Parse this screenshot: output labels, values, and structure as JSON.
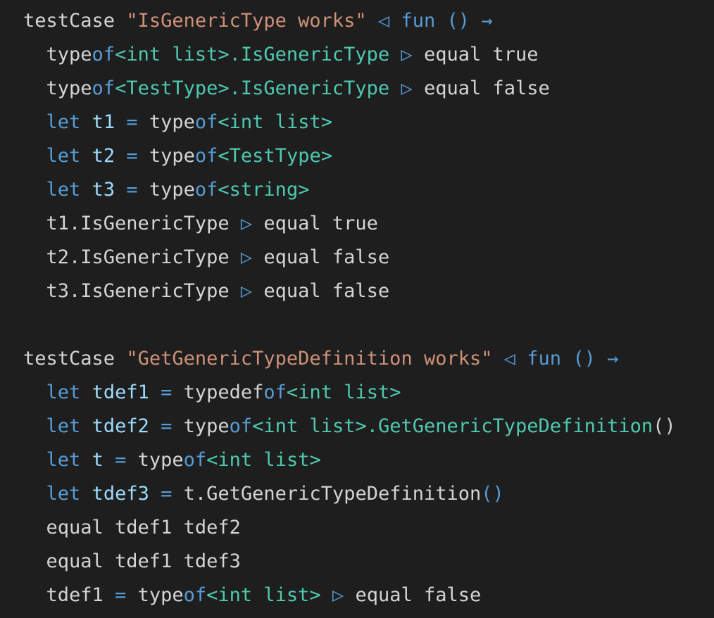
{
  "colors": {
    "background": "#1e1e1e",
    "default": "#d4d4d4",
    "keyword": "#569cd6",
    "string": "#ce9178",
    "type": "#4ec9b0",
    "variable": "#9cdcfe"
  },
  "lines": [
    {
      "tokens": [
        {
          "t": "testCase ",
          "c": "default"
        },
        {
          "t": "\"IsGenericType works\"",
          "c": "string"
        },
        {
          "t": " ",
          "c": "default"
        },
        {
          "t": "◁",
          "c": "keyword"
        },
        {
          "t": " ",
          "c": "default"
        },
        {
          "t": "fun",
          "c": "keyword"
        },
        {
          "t": " ",
          "c": "default"
        },
        {
          "t": "()",
          "c": "keyword"
        },
        {
          "t": " ",
          "c": "default"
        },
        {
          "t": "→",
          "c": "keyword"
        }
      ]
    },
    {
      "tokens": [
        {
          "t": "  type",
          "c": "default"
        },
        {
          "t": "of",
          "c": "keyword"
        },
        {
          "t": "<int list>.IsGenericType",
          "c": "type"
        },
        {
          "t": " ",
          "c": "default"
        },
        {
          "t": "▷",
          "c": "keyword"
        },
        {
          "t": " equal true",
          "c": "default"
        }
      ]
    },
    {
      "tokens": [
        {
          "t": "  type",
          "c": "default"
        },
        {
          "t": "of",
          "c": "keyword"
        },
        {
          "t": "<TestType>.IsGenericType",
          "c": "type"
        },
        {
          "t": " ",
          "c": "default"
        },
        {
          "t": "▷",
          "c": "keyword"
        },
        {
          "t": " equal false",
          "c": "default"
        }
      ]
    },
    {
      "tokens": [
        {
          "t": "  ",
          "c": "default"
        },
        {
          "t": "let",
          "c": "keyword"
        },
        {
          "t": " ",
          "c": "default"
        },
        {
          "t": "t1",
          "c": "variable"
        },
        {
          "t": " ",
          "c": "default"
        },
        {
          "t": "=",
          "c": "keyword"
        },
        {
          "t": " type",
          "c": "default"
        },
        {
          "t": "of",
          "c": "keyword"
        },
        {
          "t": "<int list>",
          "c": "type"
        }
      ]
    },
    {
      "tokens": [
        {
          "t": "  ",
          "c": "default"
        },
        {
          "t": "let",
          "c": "keyword"
        },
        {
          "t": " ",
          "c": "default"
        },
        {
          "t": "t2",
          "c": "variable"
        },
        {
          "t": " ",
          "c": "default"
        },
        {
          "t": "=",
          "c": "keyword"
        },
        {
          "t": " type",
          "c": "default"
        },
        {
          "t": "of",
          "c": "keyword"
        },
        {
          "t": "<TestType>",
          "c": "type"
        }
      ]
    },
    {
      "tokens": [
        {
          "t": "  ",
          "c": "default"
        },
        {
          "t": "let",
          "c": "keyword"
        },
        {
          "t": " ",
          "c": "default"
        },
        {
          "t": "t3",
          "c": "variable"
        },
        {
          "t": " ",
          "c": "default"
        },
        {
          "t": "=",
          "c": "keyword"
        },
        {
          "t": " type",
          "c": "default"
        },
        {
          "t": "of",
          "c": "keyword"
        },
        {
          "t": "<string>",
          "c": "type"
        }
      ]
    },
    {
      "tokens": [
        {
          "t": "  t1.IsGenericType ",
          "c": "default"
        },
        {
          "t": "▷",
          "c": "keyword"
        },
        {
          "t": " equal true",
          "c": "default"
        }
      ]
    },
    {
      "tokens": [
        {
          "t": "  t2.IsGenericType ",
          "c": "default"
        },
        {
          "t": "▷",
          "c": "keyword"
        },
        {
          "t": " equal false",
          "c": "default"
        }
      ]
    },
    {
      "tokens": [
        {
          "t": "  t3.IsGenericType ",
          "c": "default"
        },
        {
          "t": "▷",
          "c": "keyword"
        },
        {
          "t": " equal false",
          "c": "default"
        }
      ]
    },
    {
      "tokens": []
    },
    {
      "tokens": [
        {
          "t": "testCase ",
          "c": "default"
        },
        {
          "t": "\"GetGenericTypeDefinition works\"",
          "c": "string"
        },
        {
          "t": " ",
          "c": "default"
        },
        {
          "t": "◁",
          "c": "keyword"
        },
        {
          "t": " ",
          "c": "default"
        },
        {
          "t": "fun",
          "c": "keyword"
        },
        {
          "t": " ",
          "c": "default"
        },
        {
          "t": "()",
          "c": "keyword"
        },
        {
          "t": " ",
          "c": "default"
        },
        {
          "t": "→",
          "c": "keyword"
        }
      ]
    },
    {
      "tokens": [
        {
          "t": "  ",
          "c": "default"
        },
        {
          "t": "let",
          "c": "keyword"
        },
        {
          "t": " ",
          "c": "default"
        },
        {
          "t": "tdef1",
          "c": "variable"
        },
        {
          "t": " ",
          "c": "default"
        },
        {
          "t": "=",
          "c": "keyword"
        },
        {
          "t": " typedef",
          "c": "default"
        },
        {
          "t": "of",
          "c": "keyword"
        },
        {
          "t": "<int list>",
          "c": "type"
        }
      ]
    },
    {
      "tokens": [
        {
          "t": "  ",
          "c": "default"
        },
        {
          "t": "let",
          "c": "keyword"
        },
        {
          "t": " ",
          "c": "default"
        },
        {
          "t": "tdef2",
          "c": "variable"
        },
        {
          "t": " ",
          "c": "default"
        },
        {
          "t": "=",
          "c": "keyword"
        },
        {
          "t": " type",
          "c": "default"
        },
        {
          "t": "of",
          "c": "keyword"
        },
        {
          "t": "<int list>.GetGenericTypeDefinition",
          "c": "type"
        },
        {
          "t": "()",
          "c": "default"
        }
      ]
    },
    {
      "tokens": [
        {
          "t": "  ",
          "c": "default"
        },
        {
          "t": "let",
          "c": "keyword"
        },
        {
          "t": " ",
          "c": "default"
        },
        {
          "t": "t",
          "c": "variable"
        },
        {
          "t": " ",
          "c": "default"
        },
        {
          "t": "=",
          "c": "keyword"
        },
        {
          "t": " type",
          "c": "default"
        },
        {
          "t": "of",
          "c": "keyword"
        },
        {
          "t": "<int list>",
          "c": "type"
        }
      ]
    },
    {
      "tokens": [
        {
          "t": "  ",
          "c": "default"
        },
        {
          "t": "let",
          "c": "keyword"
        },
        {
          "t": " ",
          "c": "default"
        },
        {
          "t": "tdef3",
          "c": "variable"
        },
        {
          "t": " ",
          "c": "default"
        },
        {
          "t": "=",
          "c": "keyword"
        },
        {
          "t": " t.GetGenericTypeDefinition",
          "c": "default"
        },
        {
          "t": "()",
          "c": "keyword"
        }
      ]
    },
    {
      "tokens": [
        {
          "t": "  equal tdef1 tdef2",
          "c": "default"
        }
      ]
    },
    {
      "tokens": [
        {
          "t": "  equal tdef1 tdef3",
          "c": "default"
        }
      ]
    },
    {
      "tokens": [
        {
          "t": "  tdef1 ",
          "c": "default"
        },
        {
          "t": "=",
          "c": "keyword"
        },
        {
          "t": " type",
          "c": "default"
        },
        {
          "t": "of",
          "c": "keyword"
        },
        {
          "t": "<int list>",
          "c": "type"
        },
        {
          "t": " ",
          "c": "default"
        },
        {
          "t": "▷",
          "c": "keyword"
        },
        {
          "t": " equal false",
          "c": "default"
        }
      ]
    }
  ]
}
